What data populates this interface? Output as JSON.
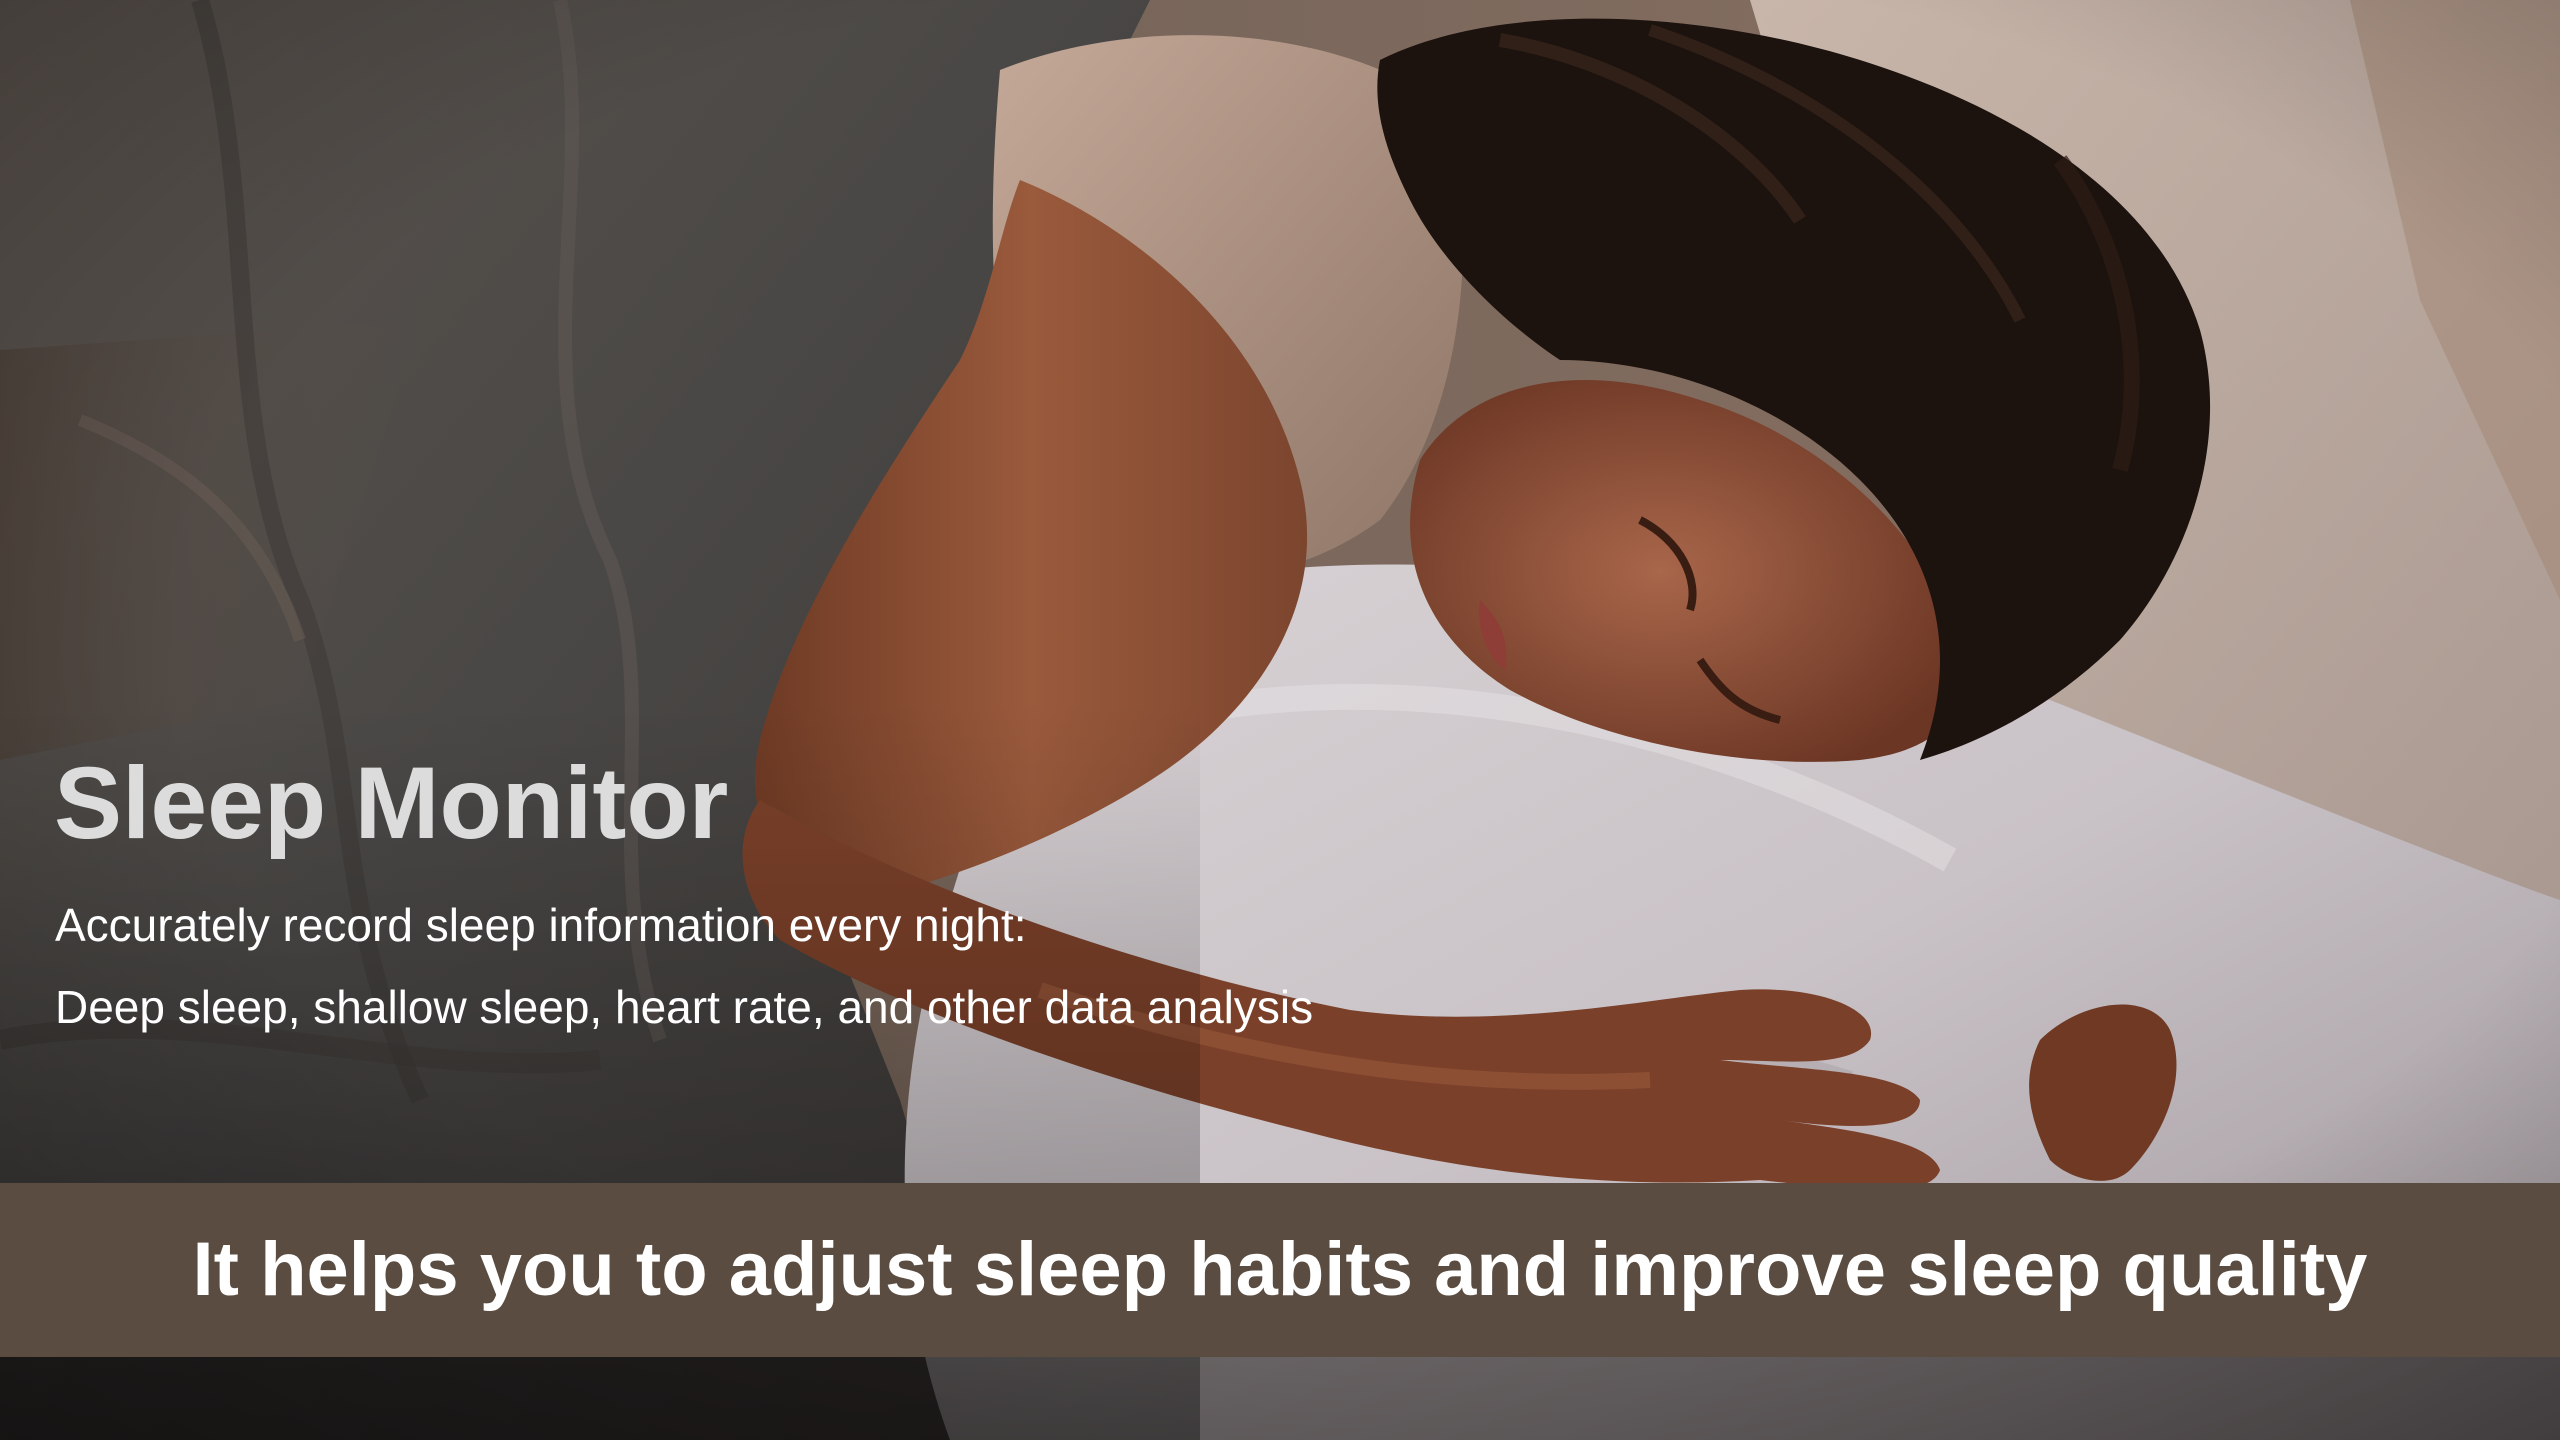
{
  "hero": {
    "title": "Sleep Monitor",
    "lines": [
      "Accurately record sleep information every night:",
      "Deep sleep, shallow sleep, heart rate, and other data analysis"
    ]
  },
  "banner": {
    "text": "It helps you to adjust sleep habits and improve sleep quality",
    "background": "#5a4c40",
    "text_color": "#ffffff"
  },
  "photo": {
    "subject": "woman-sleeping-on-pillow"
  },
  "colors": {
    "title": "#dcdcdc",
    "body_text": "#ffffff"
  }
}
